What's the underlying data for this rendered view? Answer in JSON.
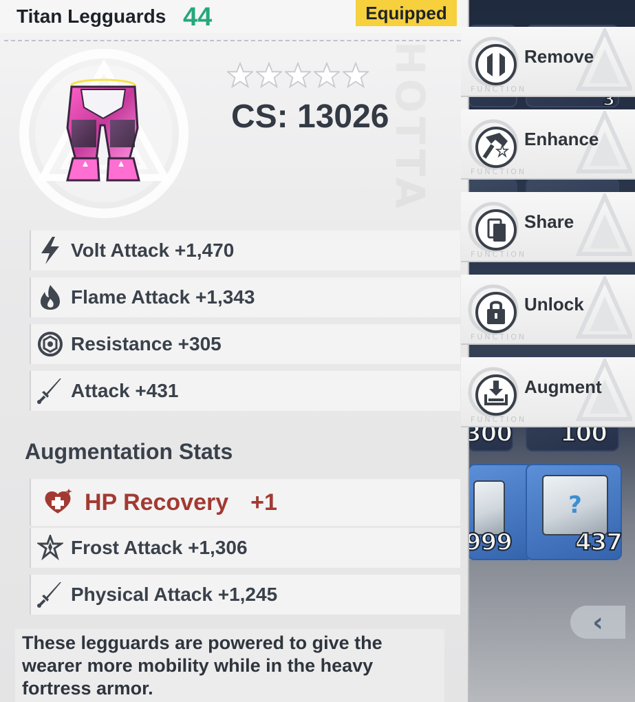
{
  "item": {
    "name": "Titan Legguards",
    "level": "44",
    "equipped_label": "Equipped",
    "stars": 5,
    "cs": "CS: 13026"
  },
  "stats": [
    {
      "icon": "volt-icon",
      "label": "Volt Attack +1,470"
    },
    {
      "icon": "flame-icon",
      "label": "Flame Attack +1,343"
    },
    {
      "icon": "resistance-icon",
      "label": "Resistance +305"
    },
    {
      "icon": "sword-icon",
      "label": "Attack +431"
    }
  ],
  "augmentation": {
    "title": "Augmentation Stats",
    "highlight": {
      "icon": "heart-plus-icon",
      "label": "HP Recovery",
      "value": "+1"
    },
    "stats": [
      {
        "icon": "frost-icon",
        "label": "Frost Attack +1,306"
      },
      {
        "icon": "sword-icon",
        "label": "Physical Attack +1,245"
      }
    ]
  },
  "description": [
    "These legguards are powered to give the",
    "wearer more mobility while in the heavy",
    "fortress armor."
  ],
  "functions": [
    {
      "icon": "remove-icon",
      "label": "Remove",
      "sub": "FUNCTION"
    },
    {
      "icon": "enhance-icon",
      "label": "Enhance",
      "sub": "FUNCTION"
    },
    {
      "icon": "share-icon",
      "label": "Share",
      "sub": "FUNCTION"
    },
    {
      "icon": "unlock-icon",
      "label": "Unlock",
      "sub": "FUNCTION"
    },
    {
      "icon": "augment-icon",
      "label": "Augment",
      "sub": "FUNCTION"
    }
  ],
  "inventory": {
    "counts": [
      "3",
      "300",
      "100",
      "999",
      "437"
    ]
  },
  "colors": {
    "level": "#27a77c",
    "equipped_bg": "#f6d03d",
    "hp_recovery": "#a23a32"
  }
}
